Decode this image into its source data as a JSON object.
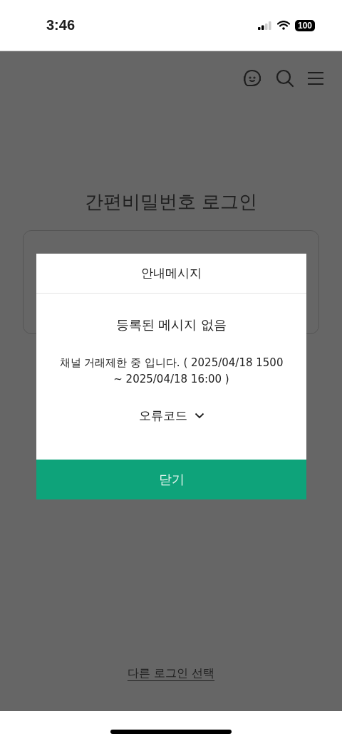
{
  "status_bar": {
    "time": "3:46",
    "battery": "100"
  },
  "page": {
    "title": "간편비밀번호 로그인",
    "other_login_link": "다른 로그인 선택"
  },
  "dialog": {
    "title": "안내메시지",
    "heading": "등록된 메시지 없음",
    "message": "채널 거래제한 중 입니다. ( 2025/04/18 1500 ~ 2025/04/18 16:00 )",
    "error_code": {
      "label": "오류코드",
      "expanded": false
    },
    "close_button": "닫기"
  }
}
